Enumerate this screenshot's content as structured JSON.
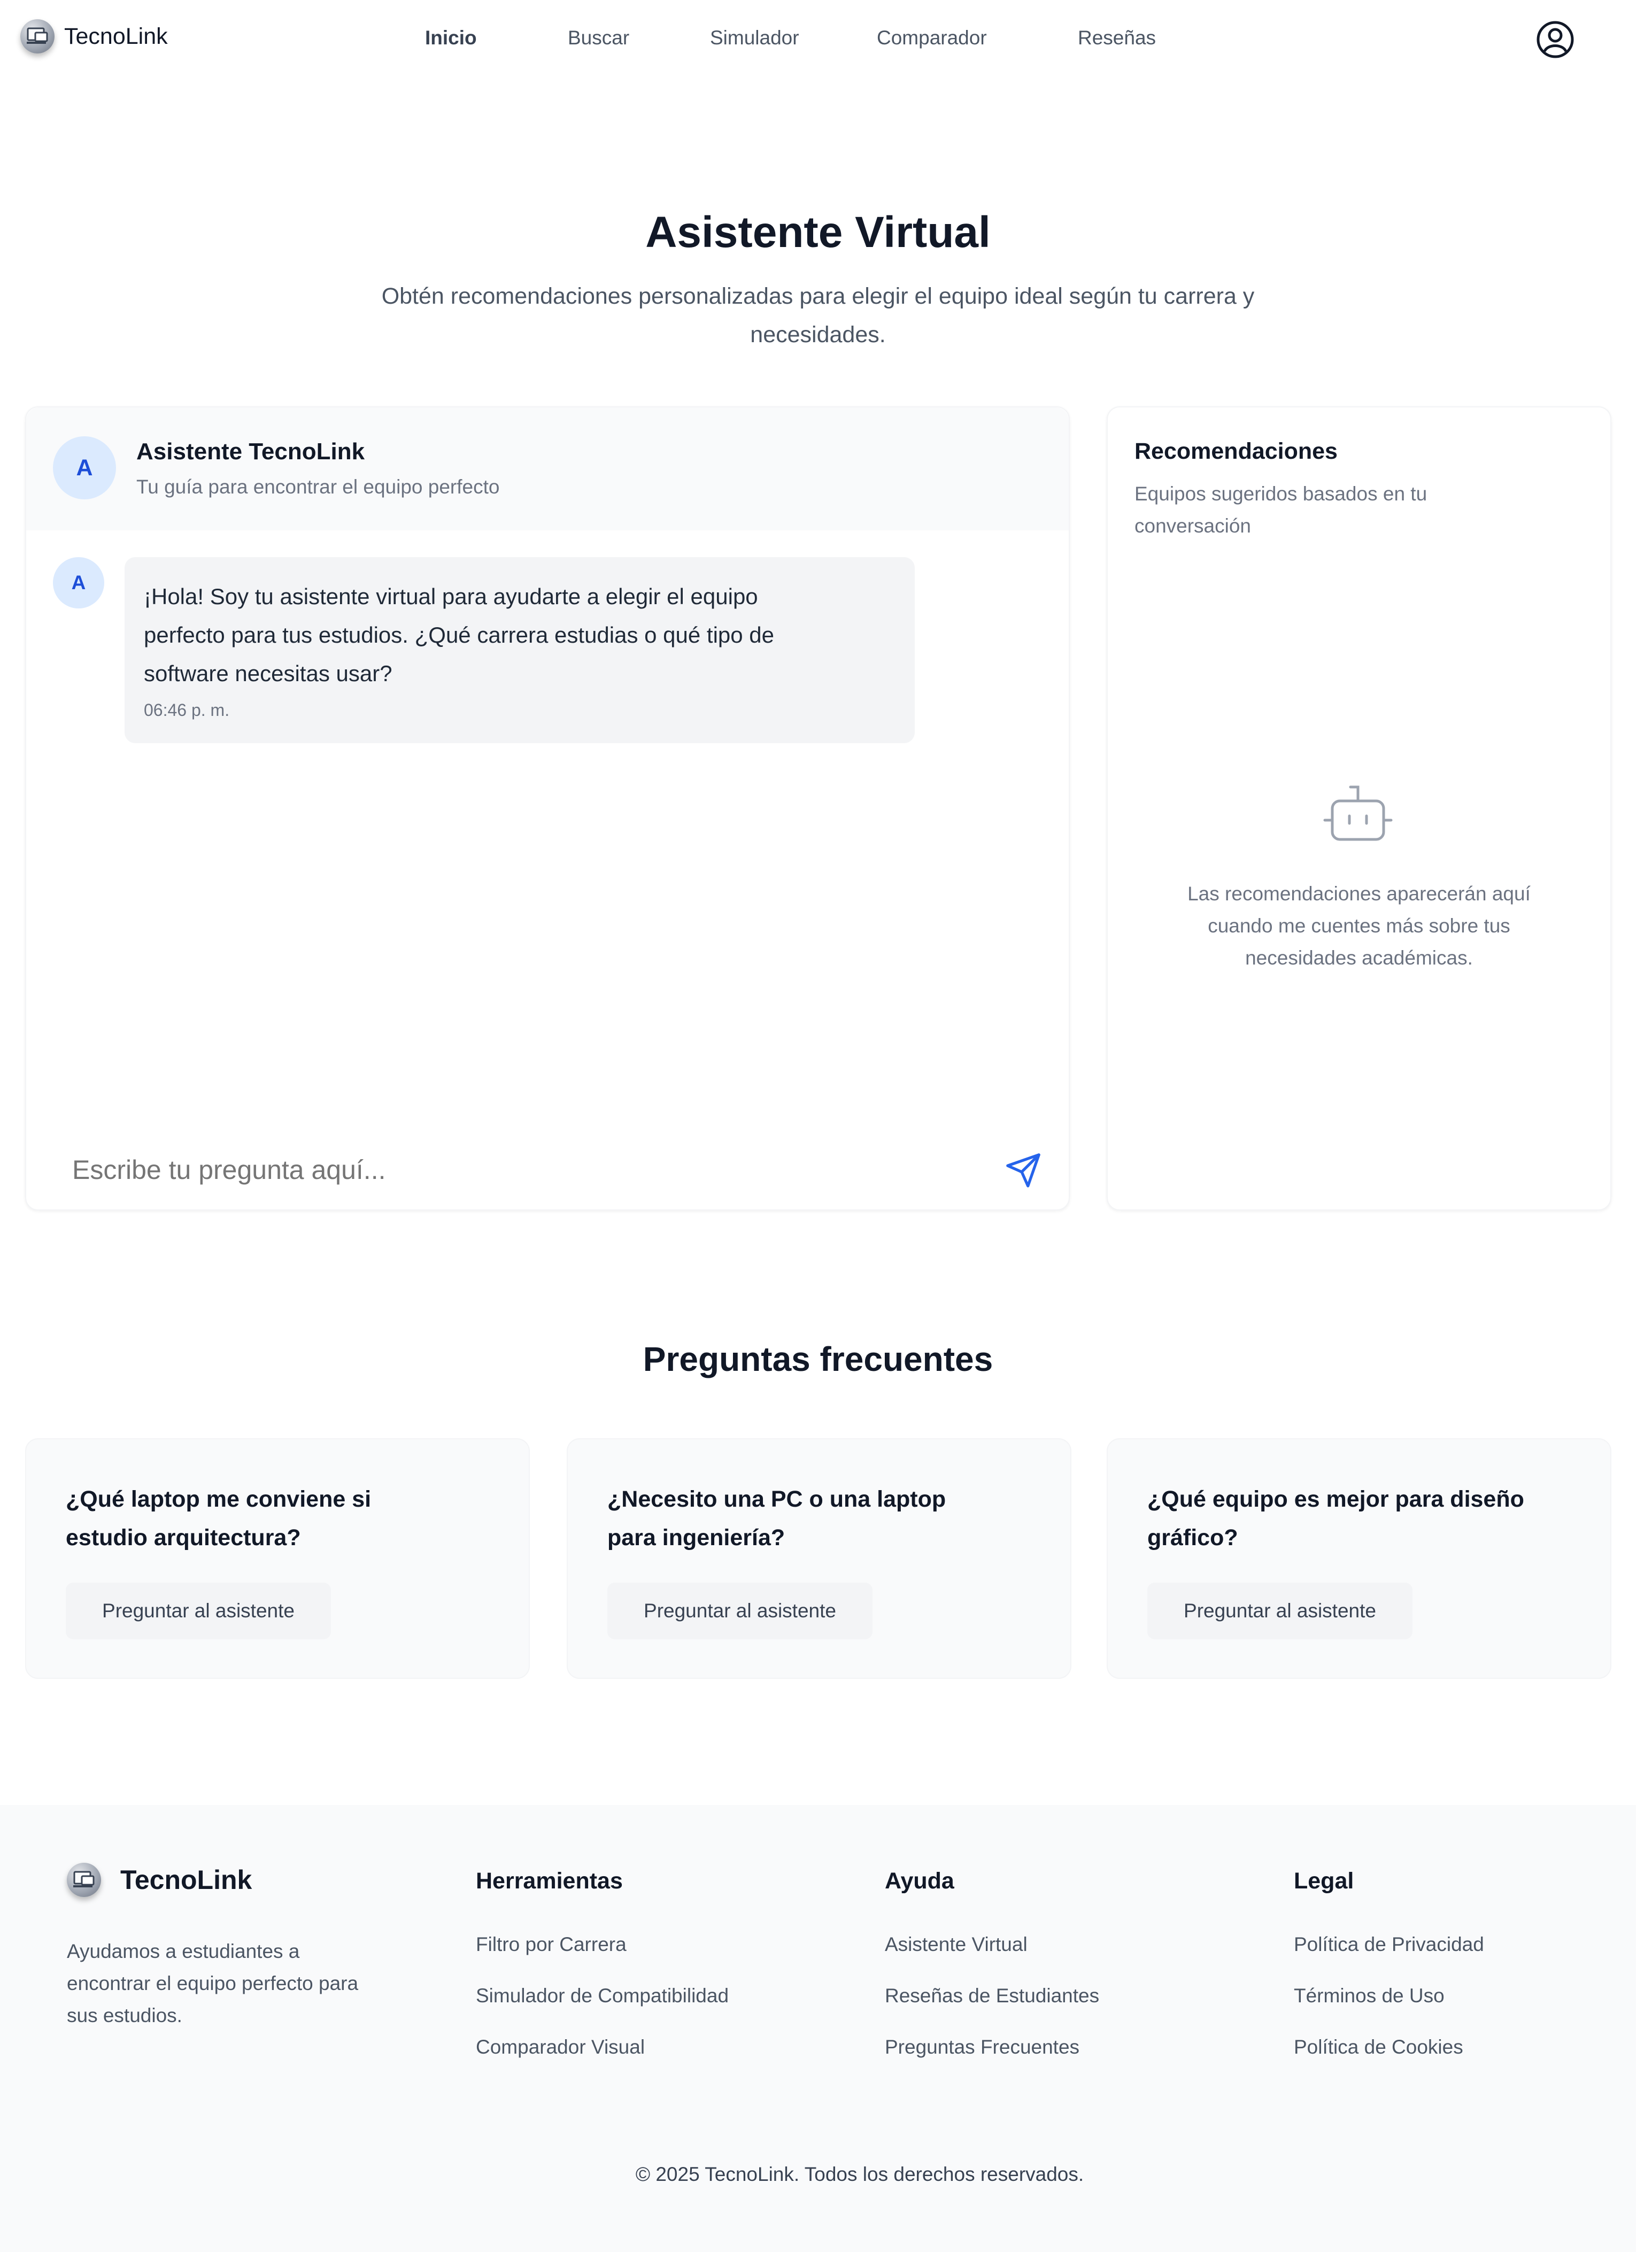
{
  "header": {
    "brand": "TecnoLink",
    "nav": [
      {
        "label": "Inicio",
        "active": true
      },
      {
        "label": "Buscar"
      },
      {
        "label": "Simulador"
      },
      {
        "label": "Comparador"
      },
      {
        "label": "Reseñas"
      }
    ]
  },
  "hero": {
    "title": "Asistente Virtual",
    "subtitle_line1": "Obtén recomendaciones personalizadas para elegir el equipo ideal según tu carrera y",
    "subtitle_line2": "necesidades."
  },
  "chat": {
    "avatar_letter": "A",
    "assistant_name": "Asistente TecnoLink",
    "assistant_tagline": "Tu guía para encontrar el equipo perfecto",
    "messages": [
      {
        "avatar": "A",
        "line1": "¡Hola! Soy tu asistente virtual para ayudarte a elegir el equipo",
        "line2": "perfecto para tus estudios. ¿Qué carrera estudias o qué tipo de",
        "line3": "software necesitas usar?",
        "time": "06:46 p. m."
      }
    ],
    "input_placeholder": "Escribe tu pregunta aquí...",
    "send_icon": "send-icon"
  },
  "recommendations": {
    "title": "Recomendaciones",
    "subtitle_line1": "Equipos sugeridos basados en tu",
    "subtitle_line2": "conversación",
    "empty_icon": "bot-icon",
    "empty_line1": "Las recomendaciones aparecerán aquí",
    "empty_line2": "cuando me cuentes más sobre tus",
    "empty_line3": "necesidades académicas."
  },
  "faq": {
    "title": "Preguntas frecuentes",
    "items": [
      {
        "q1": "¿Qué laptop me conviene si",
        "q2": "estudio arquitectura?",
        "button": "Preguntar al asistente"
      },
      {
        "q1": "¿Necesito una PC o una laptop",
        "q2": "para ingeniería?",
        "button": "Preguntar al asistente"
      },
      {
        "q1": "¿Qué equipo es mejor para diseño",
        "q2": "gráfico?",
        "button": "Preguntar al asistente"
      }
    ]
  },
  "footer": {
    "brand": "TecnoLink",
    "desc_line1": "Ayudamos a estudiantes a",
    "desc_line2": "encontrar el equipo perfecto para",
    "desc_line3": "sus estudios.",
    "columns": [
      {
        "title": "Herramientas",
        "links": [
          "Filtro por Carrera",
          "Simulador de Compatibilidad",
          "Comparador Visual"
        ]
      },
      {
        "title": "Ayuda",
        "links": [
          "Asistente Virtual",
          "Reseñas de Estudiantes",
          "Preguntas Frecuentes"
        ]
      },
      {
        "title": "Legal",
        "links": [
          "Política de Privacidad",
          "Términos de Uso",
          "Política de Cookies"
        ]
      }
    ],
    "copyright": "© 2025 TecnoLink. Todos los derechos reservados."
  },
  "colors": {
    "accent": "#2563eb",
    "avatar_bg": "#dbeafe",
    "bubble_bg": "#f3f4f6",
    "section_bg": "#f9fafb",
    "text_dark": "#111827",
    "text_muted": "#6b7280"
  }
}
